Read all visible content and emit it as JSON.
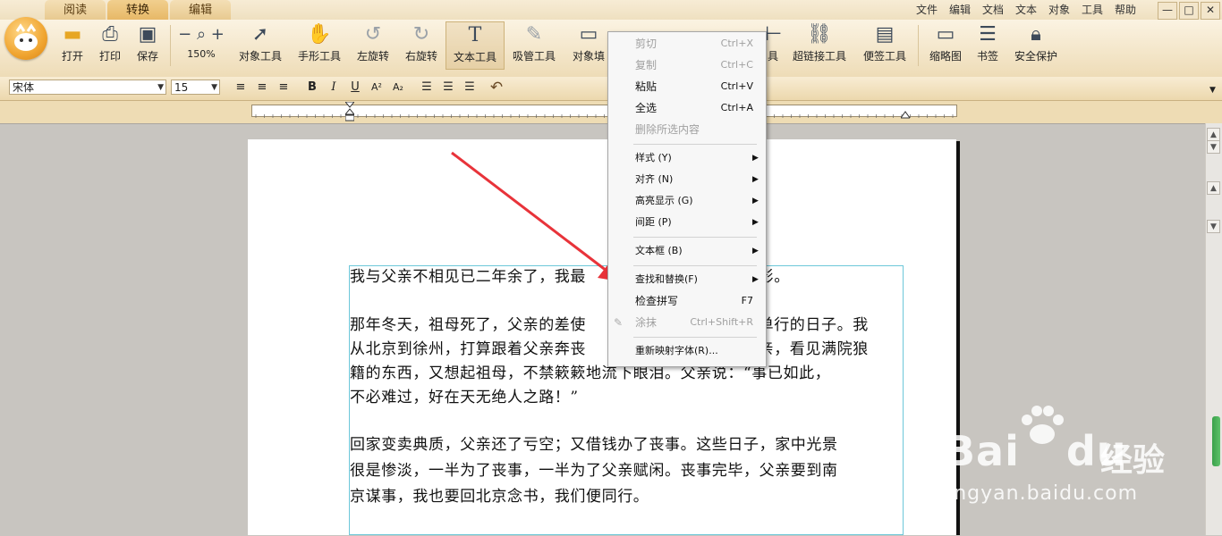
{
  "tabs": [
    "阅读",
    "转换",
    "编辑"
  ],
  "menubar": [
    "文件",
    "编辑",
    "文档",
    "文本",
    "对象",
    "工具",
    "帮助"
  ],
  "window_controls": [
    "—",
    "□",
    "✕"
  ],
  "toolbar": {
    "open": "打开",
    "print": "打印",
    "save": "保存",
    "zoom_minus": "−",
    "zoom_plus": "+",
    "zoom_level": "150%",
    "object_tool": "对象工具",
    "hand_tool": "手形工具",
    "rotate_left": "左旋转",
    "rotate_right": "右旋转",
    "text_tool": "文本工具",
    "eyedropper_tool": "吸管工具",
    "object_fill_partial": "对象填",
    "partial_tool": "具",
    "hyperlink_tool": "超链接工具",
    "note_tool": "便签工具",
    "thumbnail": "缩略图",
    "bookmark": "书签",
    "security": "安全保护"
  },
  "format": {
    "font": "宋体",
    "size": "15",
    "bold": "B",
    "italic": "I",
    "underline": "U",
    "superscript": "A²",
    "subscript": "A₂",
    "undo_icon": "undo-icon"
  },
  "document": {
    "paragraphs": [
      [
        "我与父亲不相见已二年余了，我最",
        "背影。"
      ],
      [
        "那年冬天，祖母死了，父亲的差使",
        "不单行的日子。我",
        "从北京到徐州，打算跟着父亲奔丧",
        "父亲，看见满院狼",
        "籍的东西，又想起祖母，不禁簌簌地流下眼泪。父亲说：“事已如此，",
        "不必难过，好在天无绝人之路！”"
      ],
      [
        "回家变卖典质，父亲还了亏空；又借钱办了丧事。这些日子，家中光景",
        "很是惨淡，一半为了丧事，一半为了父亲赋闲。丧事完毕，父亲要到南",
        "京谋事，我也要回北京念书，我们便同行。"
      ]
    ]
  },
  "context_menu": {
    "cut": "剪切",
    "cut_sc": "Ctrl+X",
    "copy": "复制",
    "copy_sc": "Ctrl+C",
    "paste": "粘贴",
    "paste_sc": "Ctrl+V",
    "select_all": "全选",
    "select_all_sc": "Ctrl+A",
    "delete_selected": "删除所选内容",
    "style": "样式 (Y)",
    "align": "对齐 (N)",
    "highlight": "高亮显示 (G)",
    "spacing": "间距 (P)",
    "textbox": "文本框 (B)",
    "find_replace": "查找和替换(F)",
    "spellcheck": "检查拼写",
    "spellcheck_sc": "F7",
    "smear": "涂抹",
    "smear_sc": "Ctrl+Shift+R",
    "remap_font": "重新映射字体(R)..."
  },
  "watermark": {
    "brand": "Bai",
    "brand2": "du",
    "product": "经验",
    "url": "jingyan.baidu.com"
  },
  "colors": {
    "accent": "#e8b86a",
    "arrow": "#e8333a",
    "textbox_border": "#6cc7d9",
    "scroll_thumb": "#4cb35a"
  }
}
